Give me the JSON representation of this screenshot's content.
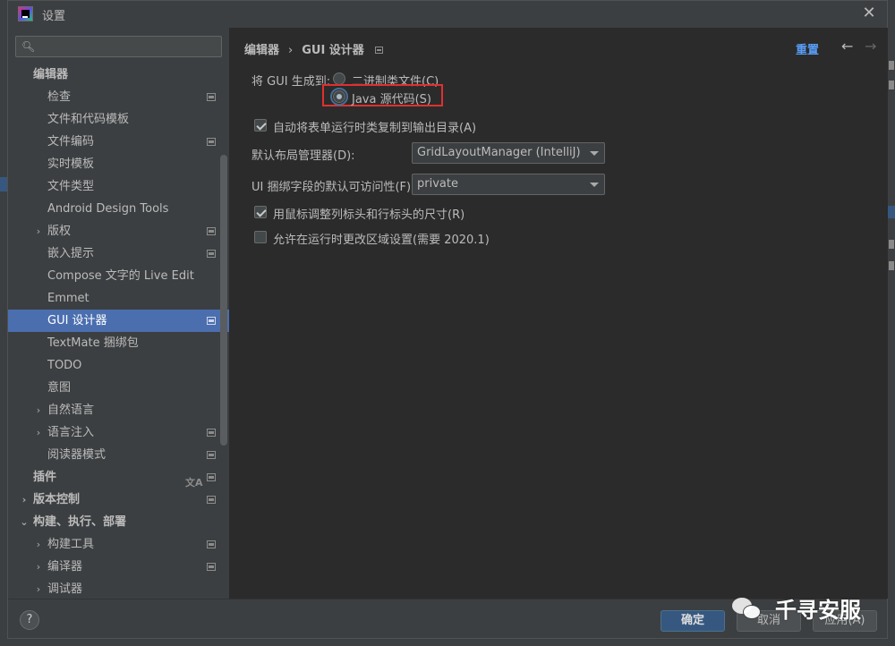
{
  "window": {
    "title": "设置"
  },
  "sidebar": {
    "search_placeholder": "",
    "items": [
      {
        "label": "编辑器",
        "bold": true
      },
      {
        "label": "检查"
      },
      {
        "label": "文件和代码模板"
      },
      {
        "label": "文件编码"
      },
      {
        "label": "实时模板"
      },
      {
        "label": "文件类型"
      },
      {
        "label": "Android Design Tools"
      },
      {
        "label": "版权"
      },
      {
        "label": "嵌入提示"
      },
      {
        "label": "Compose 文字的 Live Edit"
      },
      {
        "label": "Emmet"
      },
      {
        "label": "GUI 设计器",
        "selected": true
      },
      {
        "label": "TextMate 捆绑包"
      },
      {
        "label": "TODO"
      },
      {
        "label": "意图"
      },
      {
        "label": "自然语言"
      },
      {
        "label": "语言注入"
      },
      {
        "label": "阅读器模式"
      },
      {
        "label": "插件",
        "bold": true
      },
      {
        "label": "版本控制",
        "bold": true
      },
      {
        "label": "构建、执行、部署",
        "bold": true
      },
      {
        "label": "构建工具"
      },
      {
        "label": "编译器"
      },
      {
        "label": "调试器"
      }
    ]
  },
  "main": {
    "breadcrumb": {
      "parent": "编辑器",
      "current": "GUI 设计器"
    },
    "reset_label": "重置",
    "generate_label": "将 GUI 生成到:",
    "radio_binary": "二进制类文件(C)",
    "radio_java": "Java 源代码(S)",
    "copy_runtime": "自动将表单运行时类复制到输出目录(A)",
    "layout_manager_label": "默认布局管理器(D):",
    "layout_manager_value": "GridLayoutManager (IntelliJ)",
    "accessibility_label": "UI 捆绑字段的默认可访问性(F):",
    "accessibility_value": "private",
    "resize_headers": "用鼠标调整列标头和行标头的尺寸(R)",
    "allow_locale": "允许在运行时更改区域设置(需要 2020.1)"
  },
  "buttons": {
    "help": "?",
    "ok": "确定",
    "cancel": "取消",
    "apply": "应用(A)"
  },
  "watermark": {
    "text": "千寻安服"
  },
  "colors": {
    "accent": "#4b6eaf",
    "link": "#589df6",
    "highlight": "#e03030",
    "primary_button": "#365880"
  }
}
